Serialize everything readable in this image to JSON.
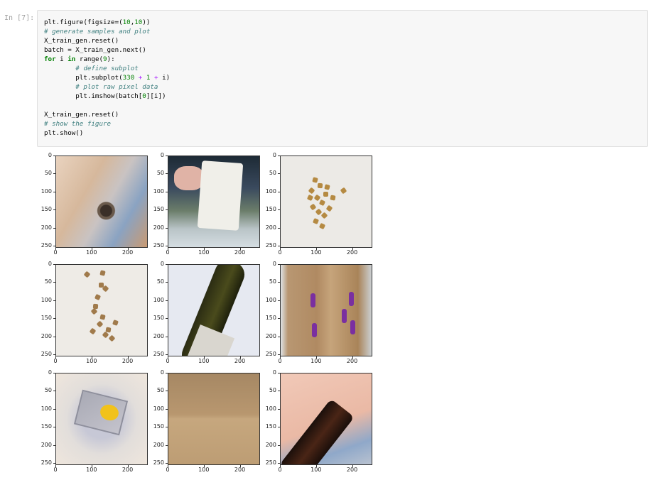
{
  "top_text": "... ... ... ... ... ... ... ...",
  "cell": {
    "prompt": "In [7]:",
    "code_lines": [
      "plt.figure(figsize=(10,10))",
      "# generate samples and plot",
      "X_train_gen.reset()",
      "batch = X_train_gen.next()",
      "for i in range(9):",
      "        # define subplot",
      "        plt.subplot(330 + 1 + i)",
      "        # plot raw pixel data",
      "        plt.imshow(batch[0][i])",
      "",
      "X_train_gen.reset()",
      "# show the figure",
      "plt.show()"
    ]
  },
  "output": {
    "subplots": [
      {
        "title": "",
        "content": "bottle-top-view"
      },
      {
        "title": "",
        "content": "hand-holding-can"
      },
      {
        "title": "",
        "content": "pile-of-peanuts"
      },
      {
        "title": "",
        "content": "scattered-pieces"
      },
      {
        "title": "",
        "content": "wine-bottle"
      },
      {
        "title": "",
        "content": "cardboard-box"
      },
      {
        "title": "",
        "content": "plastic-container"
      },
      {
        "title": "",
        "content": "cardboard-sheet"
      },
      {
        "title": "",
        "content": "dark-can"
      }
    ],
    "y_ticks": [
      "0",
      "50",
      "100",
      "150",
      "200",
      "250"
    ],
    "x_ticks": [
      "0",
      "100",
      "200"
    ]
  }
}
